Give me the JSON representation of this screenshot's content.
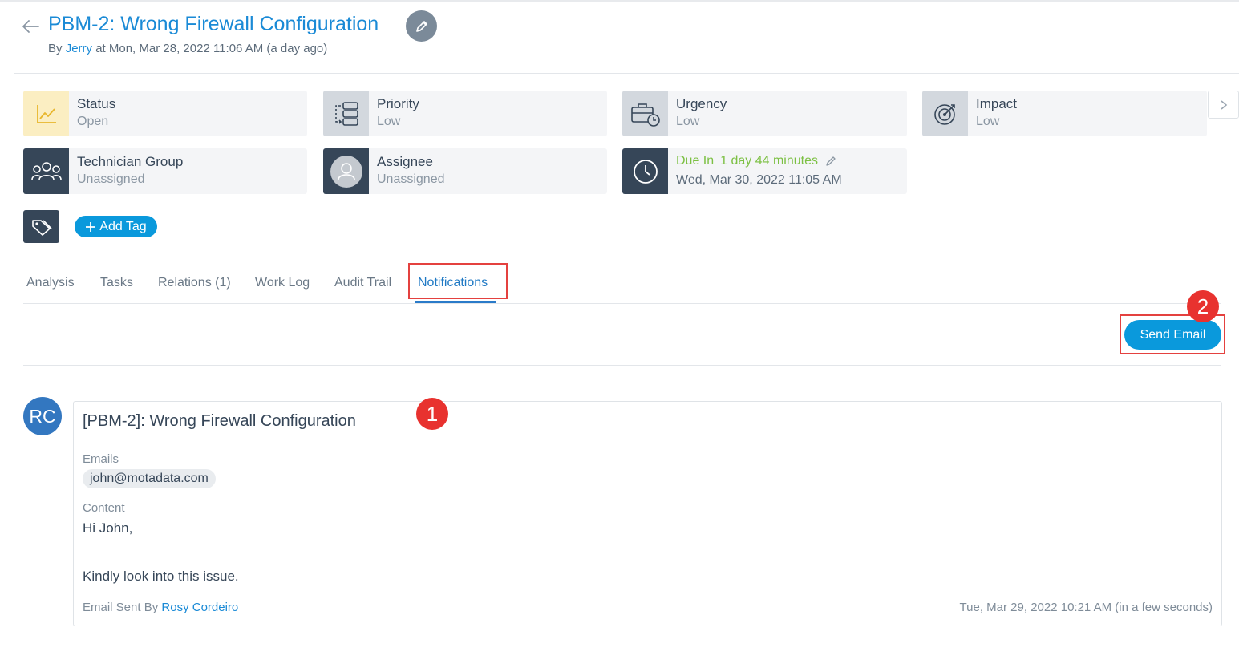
{
  "header": {
    "title": "PBM-2: Wrong Firewall Configuration",
    "by_prefix": "By",
    "author": "Jerry",
    "at_text": "at Mon, Mar 28, 2022 11:06 AM (a day ago)"
  },
  "fields": {
    "status": {
      "label": "Status",
      "value": "Open"
    },
    "priority": {
      "label": "Priority",
      "value": "Low"
    },
    "urgency": {
      "label": "Urgency",
      "value": "Low"
    },
    "impact": {
      "label": "Impact",
      "value": "Low"
    },
    "technician_group": {
      "label": "Technician Group",
      "value": "Unassigned"
    },
    "assignee": {
      "label": "Assignee",
      "value": "Unassigned"
    },
    "due": {
      "label": "Due In",
      "remaining": "1 day 44 minutes",
      "date": "Wed, Mar 30, 2022 11:05 AM"
    }
  },
  "tags": {
    "add_label": "Add Tag"
  },
  "tabs": [
    {
      "label": "Analysis"
    },
    {
      "label": "Tasks"
    },
    {
      "label": "Relations (1)"
    },
    {
      "label": "Work Log"
    },
    {
      "label": "Audit Trail"
    },
    {
      "label": "Notifications",
      "active": true
    }
  ],
  "actions": {
    "send_email": "Send Email"
  },
  "annotations": {
    "badge1": "1",
    "badge2": "2"
  },
  "notification": {
    "avatar_initials": "RC",
    "subject": "[PBM-2]: Wrong Firewall Configuration",
    "emails_label": "Emails",
    "emails": [
      "john@motadata.com"
    ],
    "content_label": "Content",
    "content_lines": [
      "Hi John,",
      "Kindly look into this issue."
    ],
    "sent_by_label": "Email Sent By",
    "sent_by": "Rosy Cordeiro",
    "timestamp": "Tue, Mar 29, 2022 10:21 AM (in a few seconds)"
  },
  "colors": {
    "accent": "#1a8ad6",
    "button": "#0a99dc",
    "highlight": "#e4413f",
    "due_green": "#7cc043",
    "dark_icon_bg": "#364658"
  }
}
